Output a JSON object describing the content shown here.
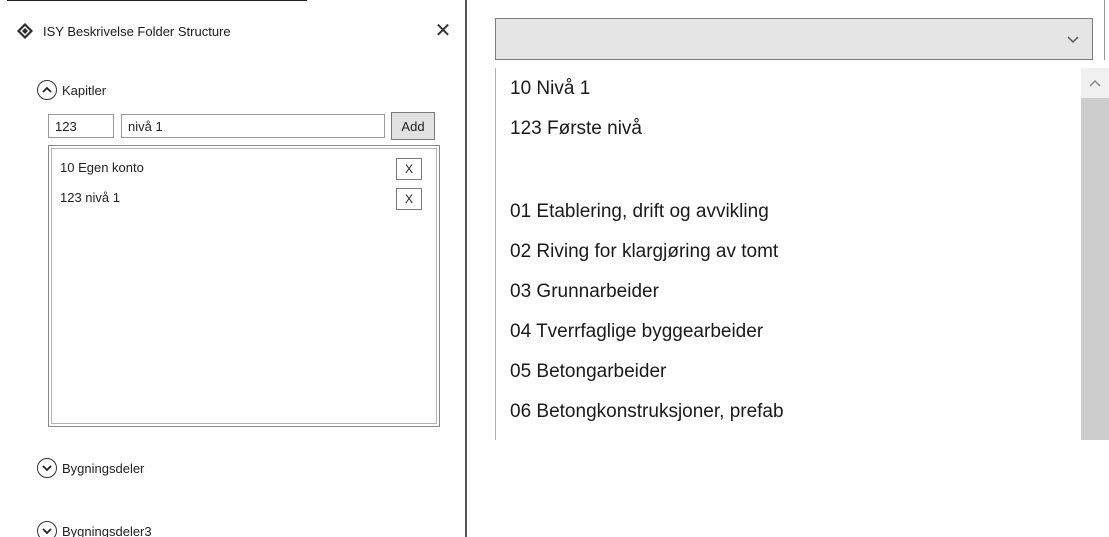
{
  "dialog": {
    "title": "ISY Beskrivelse Folder Structure",
    "close_label": "✕",
    "sections": {
      "kapitler": {
        "label": "Kapitler",
        "state": "expanded"
      },
      "bygningsdeler": {
        "label": "Bygningsdeler",
        "state": "collapsed"
      },
      "bygningsdeler3": {
        "label": "Bygningsdeler3",
        "state": "collapsed"
      }
    },
    "number_input": {
      "value": "123"
    },
    "name_input": {
      "value": "nivå 1"
    },
    "add_label": "Add",
    "remove_label": "X",
    "items": [
      {
        "label": "10 Egen konto"
      },
      {
        "label": "123 nivå 1"
      }
    ]
  },
  "combo": {
    "selected": ""
  },
  "dropdown": {
    "options": [
      "10 Nivå 1",
      "123 Første nivå",
      "",
      "01 Etablering, drift og avvikling",
      "02 Riving for klargjøring av tomt",
      "03 Grunnarbeider",
      "04 Tverrfaglige byggearbeider",
      "05 Betongarbeider",
      "06 Betongkonstruksjoner, prefab"
    ]
  },
  "colors": {
    "button_bg": "#e1e1e1",
    "combo_bg": "#e5e5e5",
    "scroll_thumb": "#cdcdcd",
    "border": "#7a7a7a"
  }
}
